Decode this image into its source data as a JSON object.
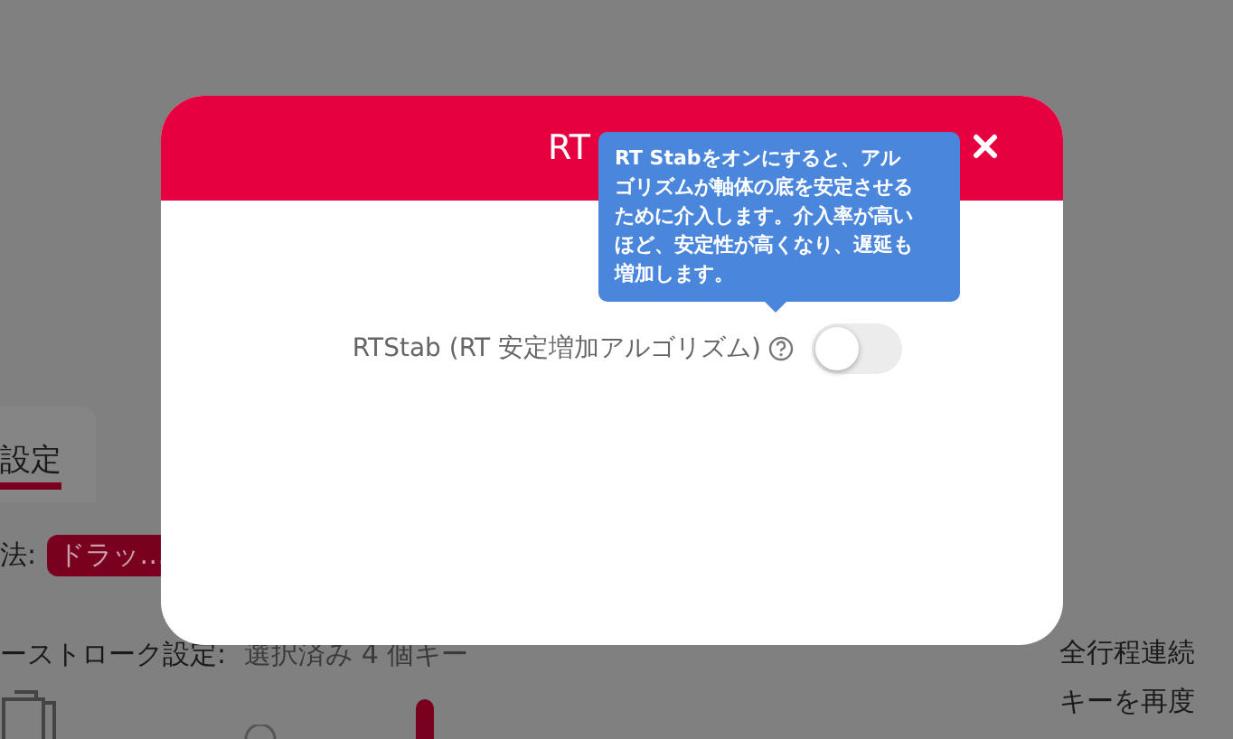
{
  "background": {
    "tab": {
      "label": "設定",
      "selected": true
    },
    "mode_label": "法:",
    "mode_value": "ドラッ…",
    "keystroke_label": "ーストローク設定:",
    "keystroke_value": "選択済み 4 個キー",
    "side_lines": [
      "全行程連続",
      "キーを再度"
    ]
  },
  "dialog": {
    "title": "RT",
    "setting": {
      "label": "RTStab (RT 安定増加アルゴリズム)",
      "on": false
    },
    "tooltip": "RT Stabをオンにすると、アルゴリズムが軸体の底を安定させるために介入します。介入率が高いほど、安定性が高くなり、遅延も増加します。"
  }
}
